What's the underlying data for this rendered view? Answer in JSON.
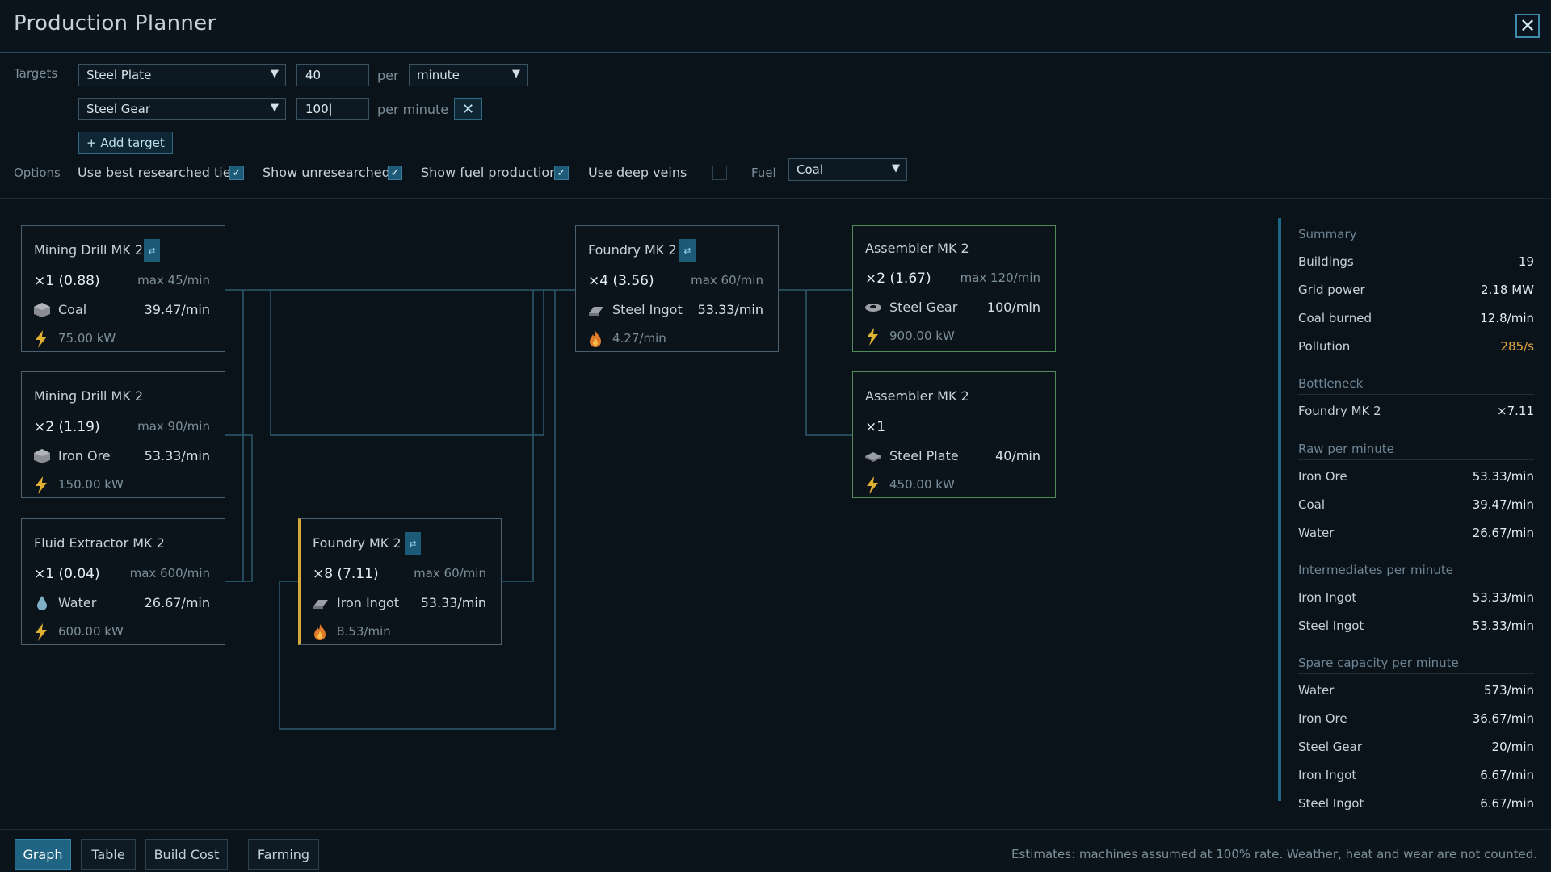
{
  "window": {
    "title": "Production Planner",
    "close_glyph": "✕"
  },
  "targets": {
    "label": "Targets",
    "rows": [
      {
        "item": "Steel Plate",
        "amount": "40",
        "per": "per",
        "unit": "minute"
      },
      {
        "item": "Steel Gear",
        "amount": "100|",
        "per": "per minute",
        "remove_glyph": "✕"
      }
    ],
    "add_label": "+ Add target",
    "dropdown_caret": "▼"
  },
  "options": {
    "label": "Options",
    "use_best_tier": {
      "label": "Use best researched tier",
      "checked": true
    },
    "show_unresearched": {
      "label": "Show unresearched",
      "checked": true
    },
    "show_fuel": {
      "label": "Show fuel production",
      "checked": true
    },
    "deep_veins": {
      "label": "Use deep veins",
      "checked": false
    },
    "fuel_label": "Fuel",
    "fuel_value": "Coal",
    "check_glyph": "✓"
  },
  "graph": {
    "swap_glyph": "⇄",
    "nodes": {
      "drill_coal": {
        "name": "Mining Drill MK 2",
        "count": "×1 (0.88)",
        "max": "max 45/min",
        "item": "Coal",
        "rate": "39.47/min",
        "sub": "75.00 kW",
        "item_icon": "cube-icon",
        "sub_icon": "lightning-icon"
      },
      "drill_iron": {
        "name": "Mining Drill MK 2",
        "count": "×2 (1.19)",
        "max": "max 90/min",
        "item": "Iron Ore",
        "rate": "53.33/min",
        "sub": "150.00 kW",
        "item_icon": "cube-icon",
        "sub_icon": "lightning-icon"
      },
      "extractor": {
        "name": "Fluid Extractor MK 2",
        "count": "×1 (0.04)",
        "max": "max 600/min",
        "item": "Water",
        "rate": "26.67/min",
        "sub": "600.00 kW",
        "item_icon": "droplet-icon",
        "sub_icon": "lightning-icon"
      },
      "foundry_iron": {
        "name": "Foundry MK 2",
        "count": "×8 (7.11)",
        "max": "max 60/min",
        "item": "Iron Ingot",
        "rate": "53.33/min",
        "sub": "8.53/min",
        "item_icon": "ingot-icon",
        "sub_icon": "flame-icon"
      },
      "foundry_steel": {
        "name": "Foundry MK 2",
        "count": "×4 (3.56)",
        "max": "max 60/min",
        "item": "Steel Ingot",
        "rate": "53.33/min",
        "sub": "4.27/min",
        "item_icon": "ingot-icon",
        "sub_icon": "flame-icon"
      },
      "assembler_gear": {
        "name": "Assembler MK 2",
        "count": "×2 (1.67)",
        "max": "max 120/min",
        "item": "Steel Gear",
        "rate": "100/min",
        "sub": "900.00 kW",
        "item_icon": "gear-icon",
        "sub_icon": "lightning-icon"
      },
      "assembler_plate": {
        "name": "Assembler MK 2",
        "count": "×1",
        "max": "",
        "item": "Steel Plate",
        "rate": "40/min",
        "sub": "450.00 kW",
        "item_icon": "plate-icon",
        "sub_icon": "lightning-icon"
      }
    }
  },
  "summary": {
    "heading": "Summary",
    "rows": [
      {
        "k": "Buildings",
        "v": "19"
      },
      {
        "k": "Grid power",
        "v": "2.18 MW"
      },
      {
        "k": "Coal burned",
        "v": "12.8/min"
      },
      {
        "k": "Pollution",
        "v": "285/s"
      }
    ],
    "bottleneck_heading": "Bottleneck",
    "bottleneck": {
      "k": "Foundry MK 2",
      "v": "×7.11"
    },
    "raw_heading": "Raw per minute",
    "raw": [
      {
        "k": "Iron Ore",
        "v": "53.33/min"
      },
      {
        "k": "Coal",
        "v": "39.47/min"
      },
      {
        "k": "Water",
        "v": "26.67/min"
      }
    ],
    "inter_heading": "Intermediates per minute",
    "inter": [
      {
        "k": "Iron Ingot",
        "v": "53.33/min"
      },
      {
        "k": "Steel Ingot",
        "v": "53.33/min"
      }
    ],
    "spare_heading": "Spare capacity per minute",
    "spare": [
      {
        "k": "Water",
        "v": "573/min"
      },
      {
        "k": "Iron Ore",
        "v": "36.67/min"
      },
      {
        "k": "Steel Gear",
        "v": "20/min"
      },
      {
        "k": "Iron Ingot",
        "v": "6.67/min"
      },
      {
        "k": "Steel Ingot",
        "v": "6.67/min"
      }
    ],
    "pollution_color": "#e0a640"
  },
  "bottom": {
    "tabs": [
      "Graph",
      "Table",
      "Build Cost",
      "Farming"
    ],
    "active_tab": "Graph",
    "footnote": "Estimates: machines assumed at 100% rate. Weather, heat and wear are not counted."
  }
}
